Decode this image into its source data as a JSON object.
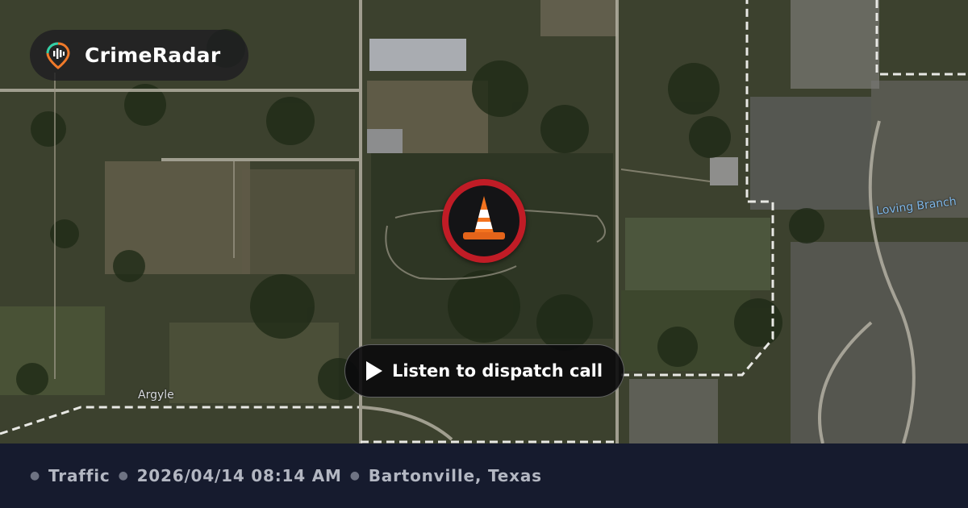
{
  "brand": {
    "name": "CrimeRadar",
    "icon": "radar-pin-icon",
    "accent": "#2fd0a9"
  },
  "incident": {
    "icon": "traffic-cone-icon",
    "ring_color": "#c01c26"
  },
  "dispatch": {
    "label": "Listen to dispatch call",
    "icon": "play-icon"
  },
  "map": {
    "labels": {
      "town": "Argyle",
      "creek": "Loving Branch"
    }
  },
  "footer": {
    "category": "Traffic",
    "datetime": "2026/04/14 08:14 AM",
    "location": "Bartonville, Texas"
  }
}
